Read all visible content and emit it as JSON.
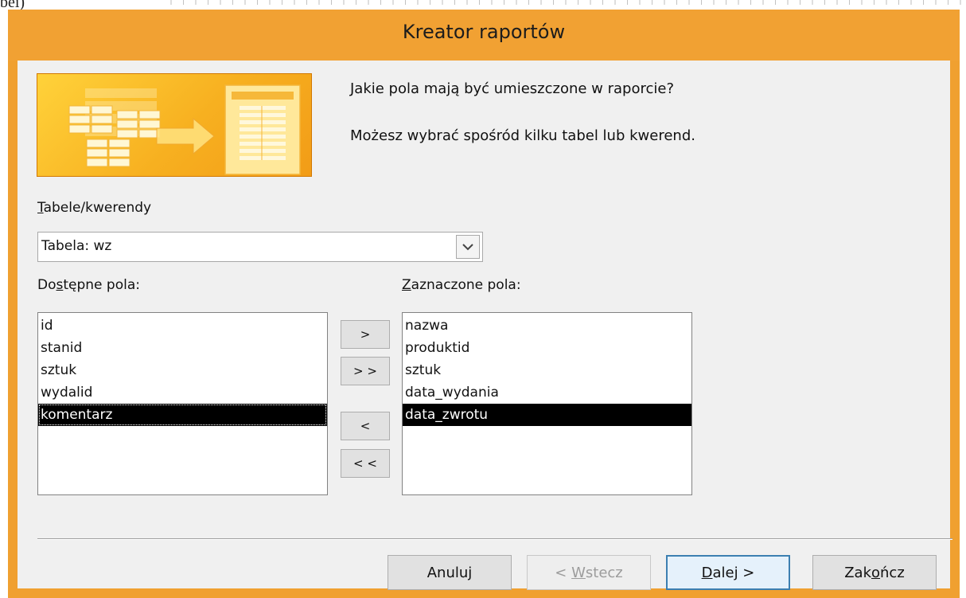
{
  "background": {
    "stray_text": "bei)"
  },
  "dialog": {
    "title": "Kreator raportów",
    "prompt_question": "Jakie pola mają być umieszczone w raporcie?",
    "prompt_hint": "Możesz wybrać spośród kilku tabel lub kwerend."
  },
  "tables": {
    "label_key": "T",
    "label_rest": "abele/kwerendy",
    "selected": "Tabela: wz"
  },
  "available": {
    "label_a": "Do",
    "label_key": "s",
    "label_b": "tępne pola:",
    "items": [
      "id",
      "stanid",
      "sztuk",
      "wydalid",
      "komentarz"
    ],
    "selected_index": 4
  },
  "chosen": {
    "label_key": "Z",
    "label_rest": "aznaczone pola:",
    "items": [
      "nazwa",
      "produktid",
      "sztuk",
      "data_wydania",
      "data_zwrotu"
    ],
    "selected_index": 4
  },
  "move_buttons": {
    "add_one": ">",
    "add_all": "> >",
    "remove_one": "<",
    "remove_all": "< <"
  },
  "buttons": {
    "cancel": "Anuluj",
    "back_a": "< ",
    "back_key": "W",
    "back_b": "stecz",
    "next_key": "D",
    "next_b": "alej >",
    "finish_a": "Zak",
    "finish_key": "o",
    "finish_b": "ńcz"
  },
  "colors": {
    "title_bar": "#f1a133",
    "selection": "#000000",
    "default_button_border": "#3c7fb1"
  },
  "icons": [
    "report-wizard-illustration",
    "chevron-down-icon"
  ]
}
